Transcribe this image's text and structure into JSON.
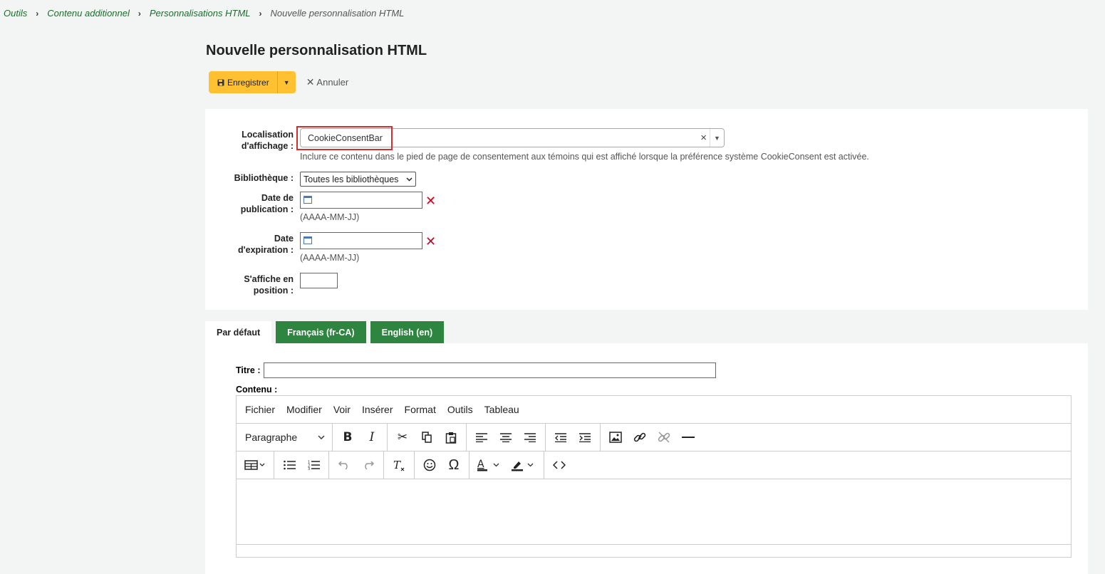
{
  "breadcrumb": {
    "items": [
      "Outils",
      "Contenu additionnel",
      "Personnalisations HTML"
    ],
    "current": "Nouvelle personnalisation HTML"
  },
  "page_title": "Nouvelle personnalisation HTML",
  "toolbar": {
    "save_label": "Enregistrer",
    "cancel_label": "Annuler"
  },
  "form": {
    "location_label_1": "Localisation",
    "location_label_2": "d'affichage :",
    "location_value": "CookieConsentBar",
    "location_hint": "Inclure ce contenu dans le pied de page de consentement aux témoins qui est affiché lorsque la préférence système CookieConsent est activée.",
    "library_label": "Bibliothèque :",
    "library_value": "Toutes les bibliothèques",
    "pubdate_label_1": "Date de",
    "pubdate_label_2": "publication :",
    "expdate_label_1": "Date",
    "expdate_label_2": "d'expiration :",
    "date_format_hint": "(AAAA-MM-JJ)",
    "position_label_1": "S'affiche en",
    "position_label_2": "position :"
  },
  "tabs": [
    "Par défaut",
    "Français (fr-CA)",
    "English (en)"
  ],
  "content": {
    "title_label": "Titre :",
    "title_value": "",
    "contenu_label": "Contenu :"
  },
  "editor": {
    "menu": [
      "Fichier",
      "Modifier",
      "Voir",
      "Insérer",
      "Format",
      "Outils",
      "Tableau"
    ],
    "block_format": "Paragraphe"
  },
  "colors": {
    "accent_yellow": "#ffc032",
    "tab_green": "#2e8540",
    "link_green": "#1e6b2e",
    "danger_red": "#d0021b"
  }
}
